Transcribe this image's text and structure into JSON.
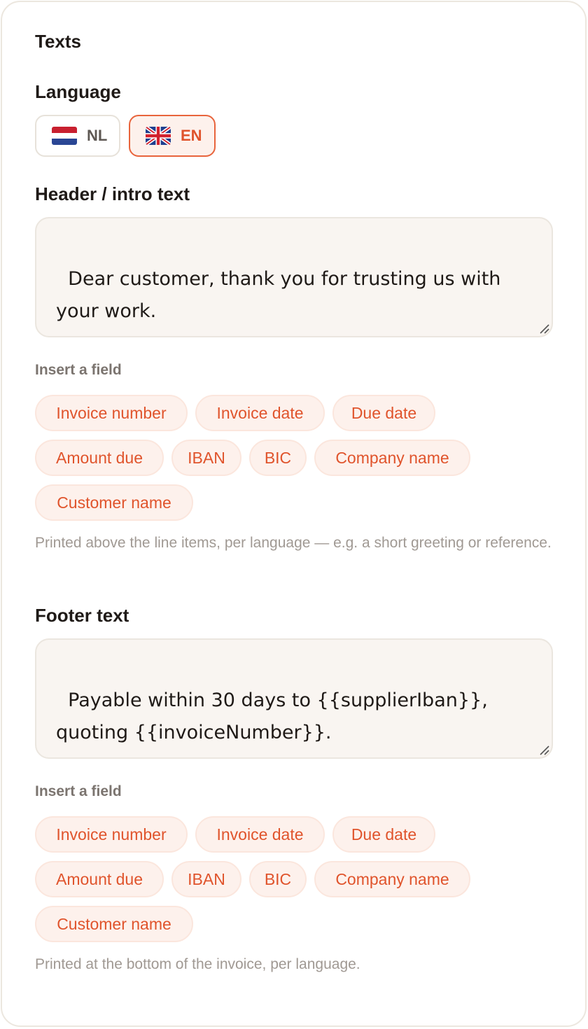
{
  "section": {
    "title": "Texts"
  },
  "language": {
    "label": "Language",
    "options": [
      {
        "code": "NL",
        "flag": "netherlands-flag-icon",
        "selected": false
      },
      {
        "code": "EN",
        "flag": "uk-flag-icon",
        "selected": true
      }
    ]
  },
  "header": {
    "label": "Header / intro text",
    "value": "Dear customer, thank you for trusting us with your work.",
    "insert_label": "Insert a field",
    "fields": [
      "Invoice number",
      "Invoice date",
      "Due date",
      "Amount due",
      "IBAN",
      "BIC",
      "Company name",
      "Customer name"
    ],
    "helper": "Printed above the line items, per language — e.g. a short greeting or reference."
  },
  "footer": {
    "label": "Footer text",
    "value": "Payable within 30 days to {{supplierIban}}, quoting {{invoiceNumber}}.",
    "insert_label": "Insert a field",
    "fields": [
      "Invoice number",
      "Invoice date",
      "Due date",
      "Amount due",
      "IBAN",
      "BIC",
      "Company name",
      "Customer name"
    ],
    "helper": "Printed at the bottom of the invoice, per language."
  },
  "colors": {
    "accent": "#e0542c",
    "chip_bg": "#fdf1ec",
    "textarea_bg": "#f9f5f1",
    "border": "#ece7df"
  }
}
